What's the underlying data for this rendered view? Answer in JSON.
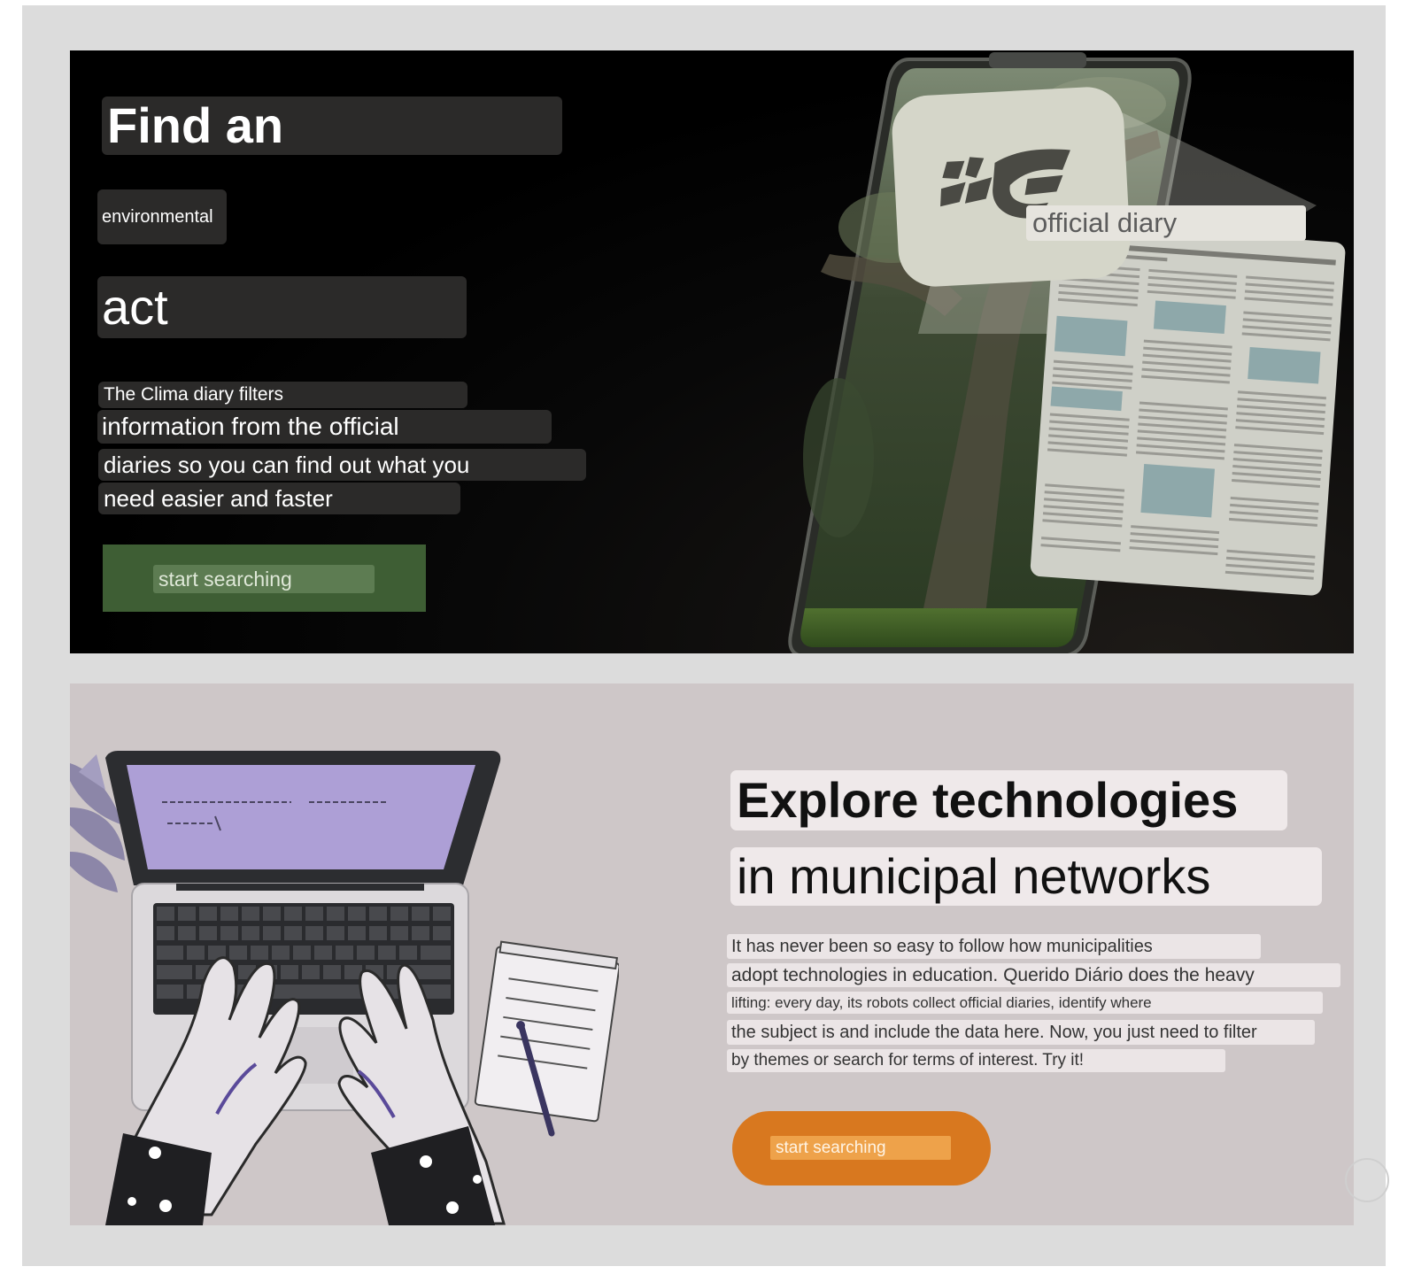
{
  "hero": {
    "heading_line1": "Find an",
    "heading_line2": "environmental",
    "heading_line3": "act",
    "description": [
      "The Clima diary filters",
      "information from the official",
      "diaries so you can find out what you",
      "need easier and faster"
    ],
    "cta_label": "start searching",
    "mockup_label": "official diary",
    "colors": {
      "background": "#000000",
      "cta": "#3e5e34"
    }
  },
  "section2": {
    "title_line1": "Explore technologies",
    "title_line2": "in municipal networks",
    "body": [
      "It has never been so easy to follow how municipalities",
      "adopt technologies in education. Querido Diário does the heavy",
      "lifting: every day, its robots collect official diaries, identify where",
      "the subject is and include the data here. Now, you just need to filter",
      "by themes or search for terms of interest. Try it!"
    ],
    "cta_label": "start searching",
    "colors": {
      "background": "#cec7c8",
      "cta": "#d8781f",
      "screen": "#ad9fd6"
    }
  },
  "icons": {
    "logo": "leaf-logo-icon",
    "laptop": "laptop-illustration",
    "notepad": "notepad-icon",
    "pencil": "pencil-icon"
  }
}
